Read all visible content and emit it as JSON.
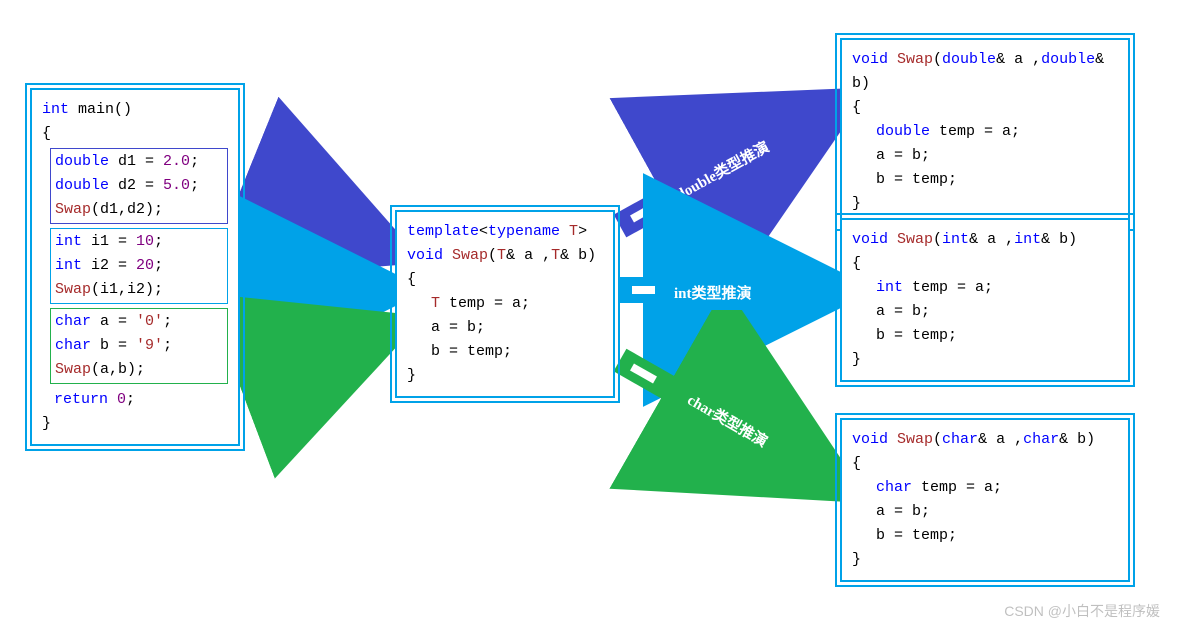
{
  "main": {
    "sig_kw": "int",
    "sig_fn": "main",
    "sig_paren": "()",
    "open": "{",
    "close": "}",
    "block1": {
      "l1_kw": "double",
      "l1_var": " d1 ",
      "l1_eq": "=",
      "l1_val": " 2.0",
      "l1_semi": ";",
      "l2_kw": "double",
      "l2_var": " d2 ",
      "l2_eq": "=",
      "l2_val": " 5.0",
      "l2_semi": ";",
      "l3_fn": "Swap",
      "l3_args": "(d1,d2);"
    },
    "block2": {
      "l1_kw": "int",
      "l1_var": " i1 ",
      "l1_eq": "=",
      "l1_val": " 10",
      "l1_semi": ";",
      "l2_kw": "int",
      "l2_var": " i2 ",
      "l2_eq": "=",
      "l2_val": " 20",
      "l2_semi": ";",
      "l3_fn": "Swap",
      "l3_args": "(i1,i2);"
    },
    "block3": {
      "l1_kw": "char",
      "l1_var": " a ",
      "l1_eq": "=",
      "l1_val": " '0'",
      "l1_semi": ";",
      "l2_kw": "char",
      "l2_var": " b ",
      "l2_eq": "=",
      "l2_val": " '9'",
      "l2_semi": ";",
      "l3_fn": "Swap",
      "l3_args": "(a,b);"
    },
    "ret_kw": "return",
    "ret_val": " 0",
    "ret_semi": ";"
  },
  "template": {
    "l1_kw": "template",
    "l1_lt": "<",
    "l1_tn": "typename",
    "l1_T": " T",
    "l1_gt": ">",
    "l2_kw": "void",
    "l2_fn": " Swap",
    "l2_args_open": "(",
    "l2_T1": "T",
    "l2_a": "& a ,",
    "l2_T2": "T",
    "l2_b": "& b)",
    "open": "{",
    "l4_T": "T",
    "l4_rest": " temp = a;",
    "l5": "a = b;",
    "l6": "b = temp;",
    "close": "}"
  },
  "out1": {
    "l1_kw": "void",
    "l1_fn": " Swap",
    "l1_open": "(",
    "l1_t1": "double",
    "l1_a": "& a ,",
    "l1_t2": "double",
    "l1_b": "& b)",
    "open": "{",
    "l3_t": "double",
    "l3_rest": " temp = a;",
    "l4": "a = b;",
    "l5": "b = temp;",
    "close": "}"
  },
  "out2": {
    "l1_kw": "void",
    "l1_fn": " Swap",
    "l1_open": "(",
    "l1_t1": "int",
    "l1_a": "& a ,",
    "l1_t2": "int",
    "l1_b": "& b)",
    "open": "{",
    "l3_t": "int",
    "l3_rest": " temp = a;",
    "l4": "a = b;",
    "l5": "b = temp;",
    "close": "}"
  },
  "out3": {
    "l1_kw": "void",
    "l1_fn": " Swap",
    "l1_open": "(",
    "l1_t1": "char",
    "l1_a": "& a ,",
    "l1_t2": "char",
    "l1_b": "& b)",
    "open": "{",
    "l3_t": "char",
    "l3_rest": " temp = a;",
    "l4": "a = b;",
    "l5": "b = temp;",
    "close": "}"
  },
  "labels": {
    "double": "double类型推演",
    "int": "int类型推演",
    "char": "char类型推演"
  },
  "watermark": "CSDN @小白不是程序媛",
  "colors": {
    "purple": "#3f48cc",
    "cyan": "#00a2e8",
    "green": "#22b14c"
  }
}
